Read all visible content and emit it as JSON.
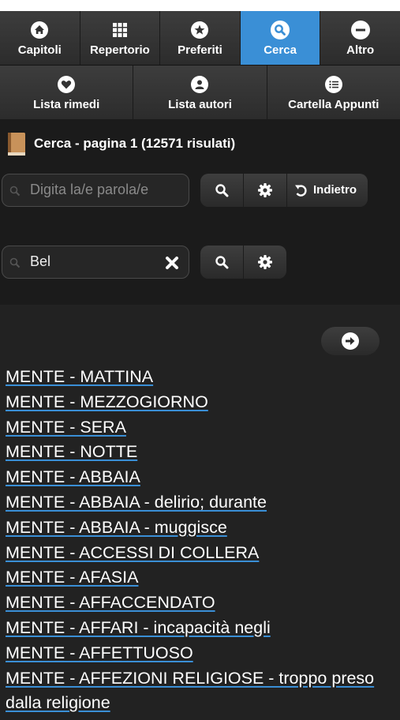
{
  "nav": {
    "row1": [
      {
        "label": "Capitoli",
        "icon": "home-icon",
        "active": false
      },
      {
        "label": "Repertorio",
        "icon": "grid-icon",
        "active": false
      },
      {
        "label": "Preferiti",
        "icon": "star-icon",
        "active": false
      },
      {
        "label": "Cerca",
        "icon": "search-icon",
        "active": true
      },
      {
        "label": "Altro",
        "icon": "minus-circle-icon",
        "active": false
      }
    ],
    "row2": [
      {
        "label": "Lista rimedi",
        "icon": "heart-icon"
      },
      {
        "label": "Lista autori",
        "icon": "person-icon"
      },
      {
        "label": "Cartella Appunti",
        "icon": "list-icon"
      }
    ]
  },
  "header": {
    "title": "Cerca - pagina 1 (12571 risulati)"
  },
  "search1": {
    "placeholder": "Digita la/e parola/e",
    "value": "",
    "back_label": "Indietro"
  },
  "search2": {
    "placeholder": "",
    "value": "Bel"
  },
  "results": [
    "MENTE - MATTINA",
    "MENTE - MEZZOGIORNO",
    "MENTE - SERA",
    "MENTE - NOTTE",
    "MENTE - ABBAIA",
    "MENTE - ABBAIA - delirio; durante",
    "MENTE - ABBAIA - muggisce",
    "MENTE - ACCESSI DI COLLERA",
    "MENTE - AFASIA",
    "MENTE - AFFACCENDATO",
    "MENTE - AFFARI - incapacità negli",
    "MENTE - AFFETTUOSO",
    "MENTE - AFFEZIONI RELIGIOSE - troppo preso dalla religione"
  ],
  "colors": {
    "accent": "#3a8fd6",
    "background": "#1b1b1b",
    "results_background": "#222222"
  }
}
